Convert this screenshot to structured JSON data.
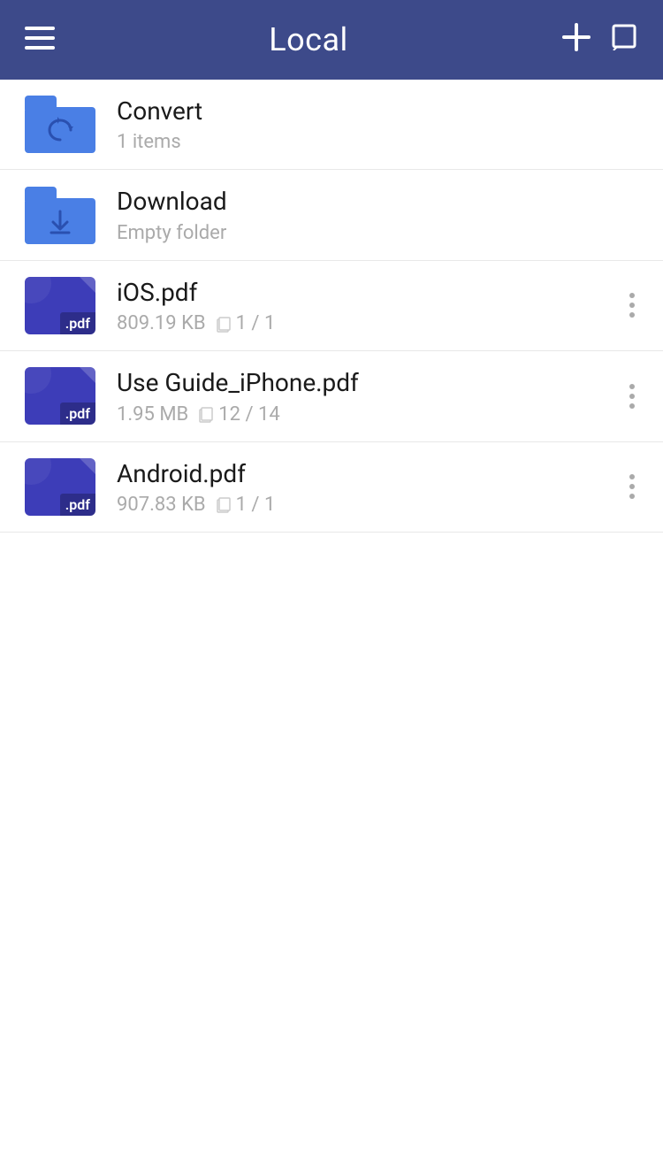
{
  "header": {
    "title": "Local",
    "menu_icon": "☰",
    "add_icon": "+",
    "edit_icon": "edit"
  },
  "items": [
    {
      "id": "convert-folder",
      "type": "folder",
      "folder_variant": "convert",
      "name": "Convert",
      "meta": "1 items",
      "has_more": false
    },
    {
      "id": "download-folder",
      "type": "folder",
      "folder_variant": "download",
      "name": "Download",
      "meta": "Empty folder",
      "has_more": false
    },
    {
      "id": "ios-pdf",
      "type": "pdf",
      "name": "iOS.pdf",
      "size": "809.19 KB",
      "pages": "1 / 1",
      "has_more": true
    },
    {
      "id": "useguide-pdf",
      "type": "pdf",
      "name": "Use Guide_iPhone.pdf",
      "size": "1.95 MB",
      "pages": "12 / 14",
      "has_more": true
    },
    {
      "id": "android-pdf",
      "type": "pdf",
      "name": "Android.pdf",
      "size": "907.83 KB",
      "pages": "1 / 1",
      "has_more": true
    }
  ],
  "colors": {
    "header_bg": "#3d4a8a",
    "folder_blue": "#4a7fe5",
    "pdf_blue": "#3d3db8"
  }
}
